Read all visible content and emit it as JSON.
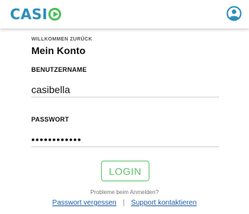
{
  "header": {
    "logo_text_main": "CASI",
    "logo_icon": "play-circle-icon",
    "account_icon": "user-circle-icon",
    "brand_color": "#2d8fba",
    "accent_color": "#4cbf5a"
  },
  "login": {
    "eyebrow": "WILLKOMMEN ZURÜCK",
    "title": "Mein Konto",
    "username_label": "BENUTZERNAME",
    "username_value": "casibella",
    "password_label": "PASSWORT",
    "password_value": "••••••••••••",
    "login_button": "LOGIN",
    "help_text": "Probleme beim Anmelden?",
    "forgot_link": "Passwort vergessen",
    "separator": "|",
    "support_link": "Support kontaktieren"
  }
}
